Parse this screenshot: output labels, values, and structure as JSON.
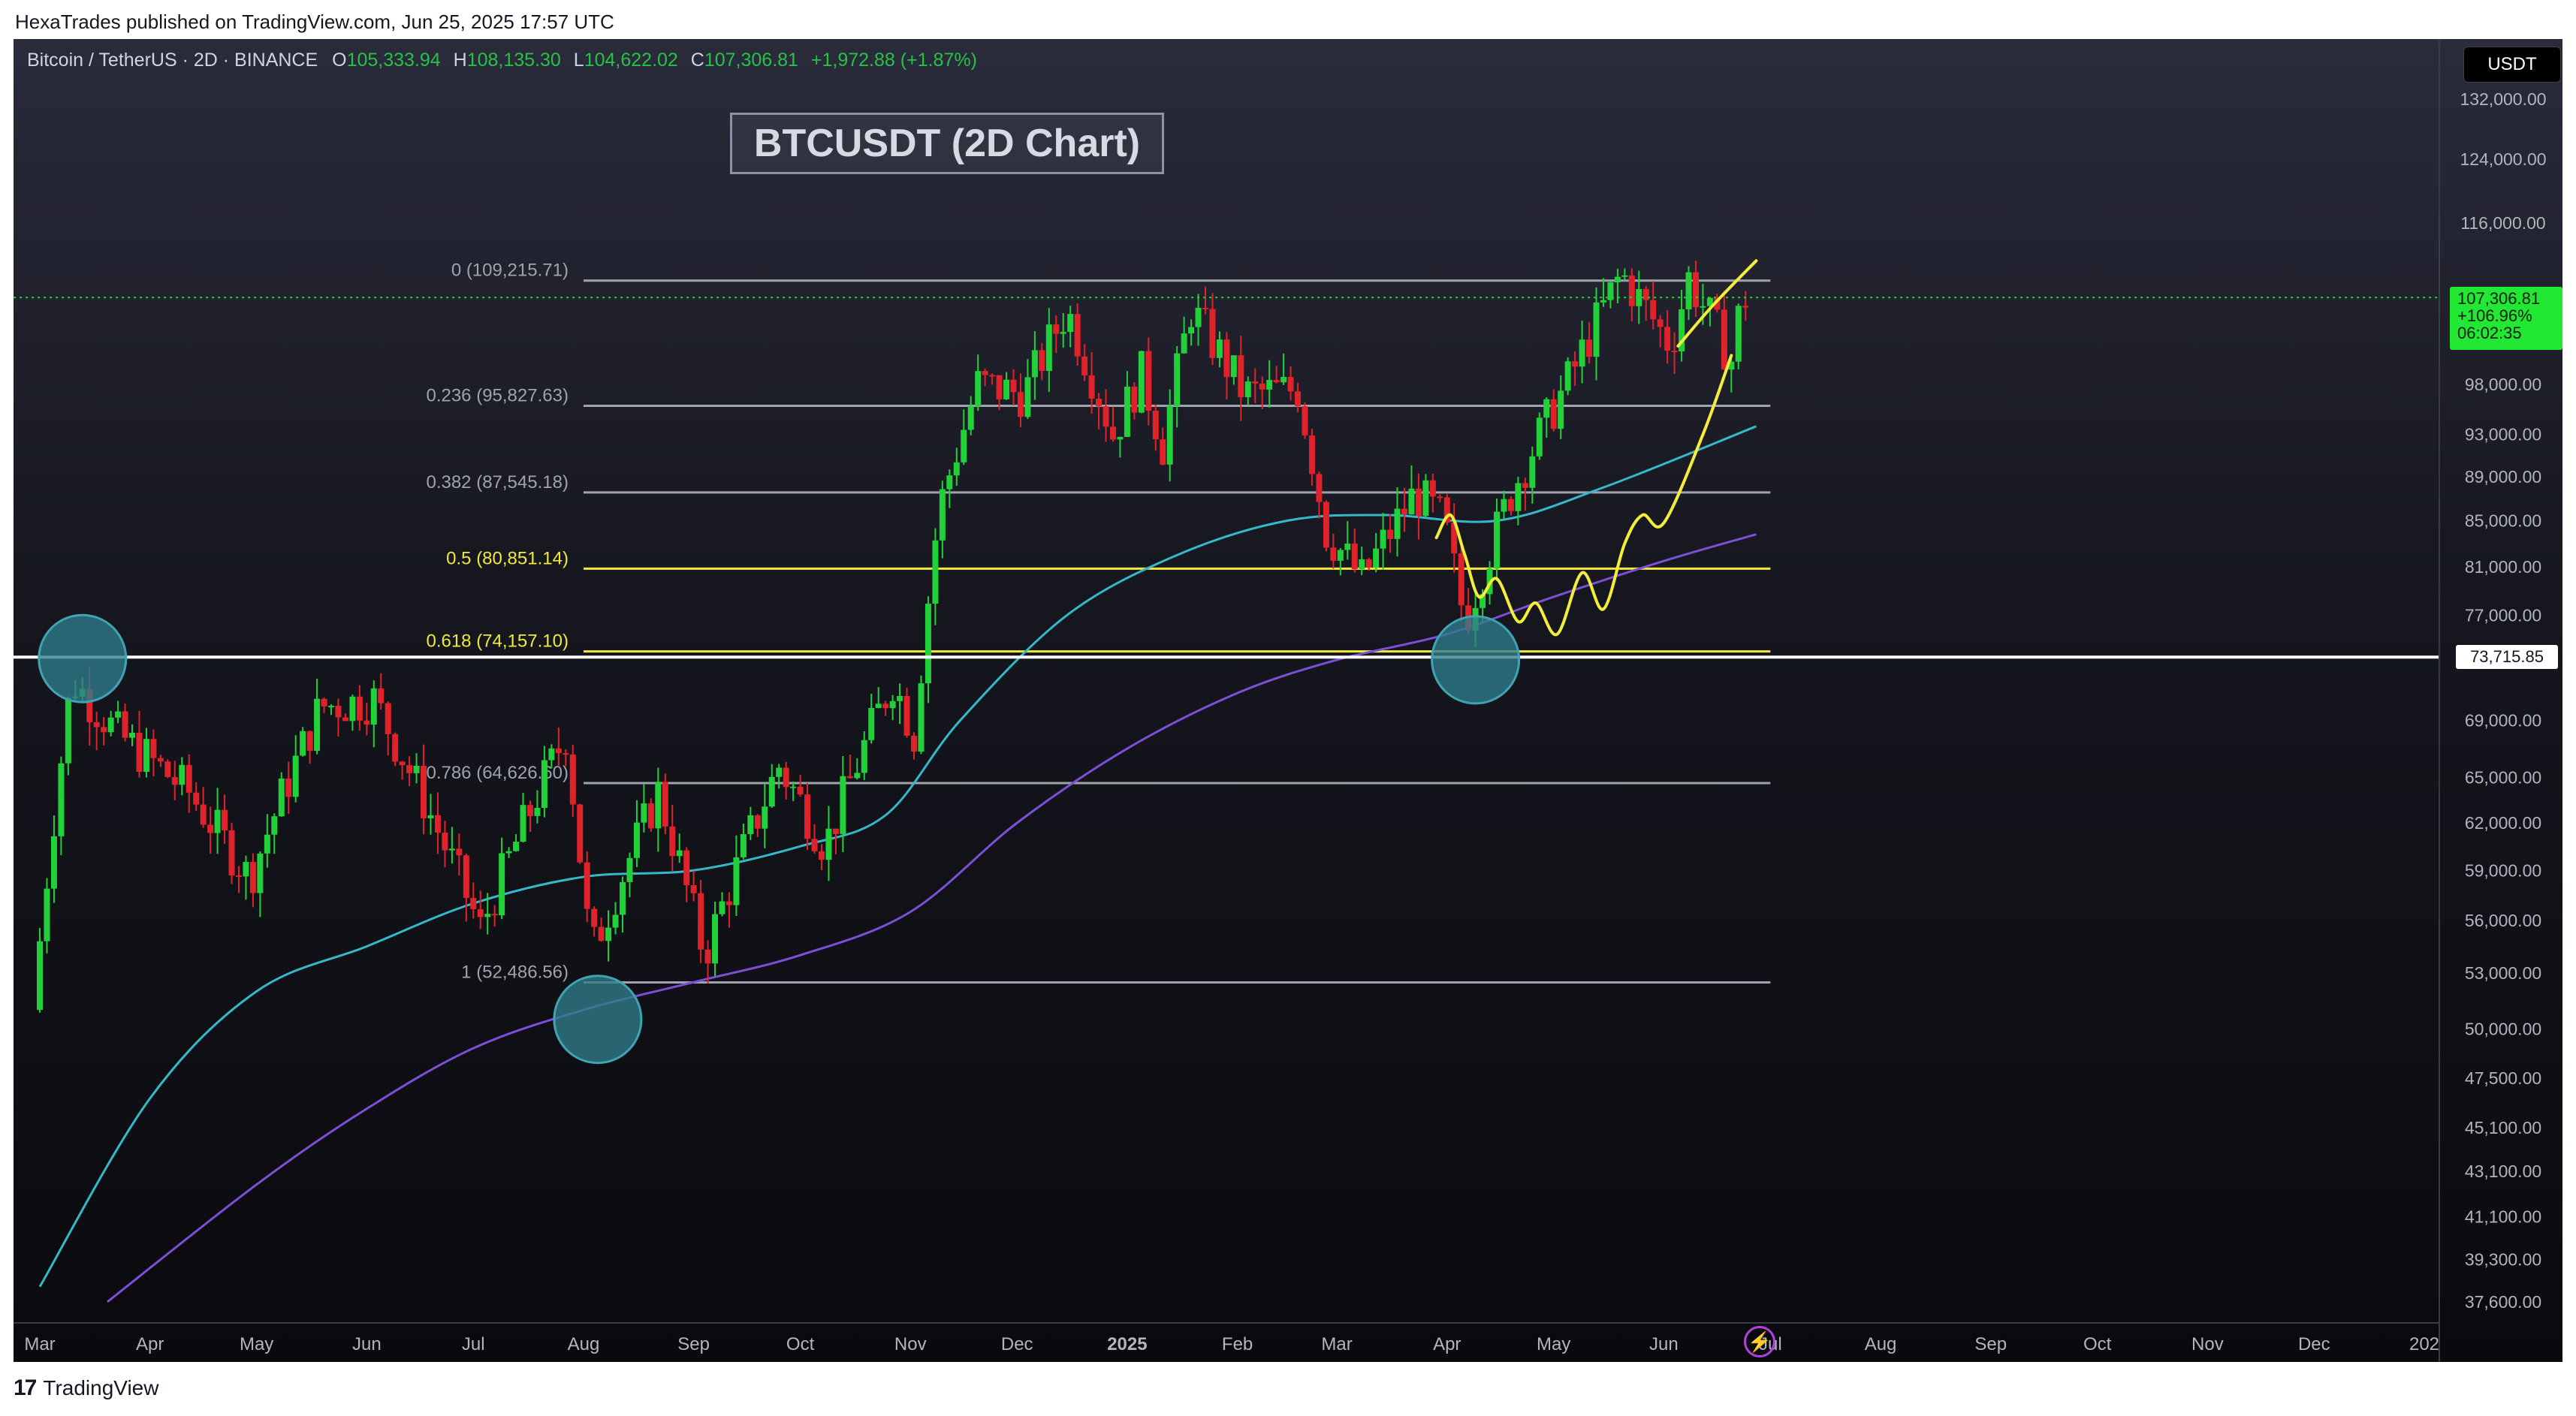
{
  "header": {
    "credit": "HexaTrades published on TradingView.com, Jun 25, 2025 17:57 UTC"
  },
  "legend": {
    "symbol": "Bitcoin / TetherUS · 2D · BINANCE",
    "o_label": "O",
    "o_value": "105,333.94",
    "h_label": "H",
    "h_value": "108,135.30",
    "l_label": "L",
    "l_value": "104,622.02",
    "c_label": "C",
    "c_value": "107,306.81",
    "change": "+1,972.88 (+1.87%)"
  },
  "toolbar": {
    "currency": "USDT"
  },
  "price_badge": {
    "price": "107,306.81",
    "pct": "+106.96%",
    "countdown": "06:02:35"
  },
  "level_badge": "73,715.85",
  "footer": {
    "logo_glyph": "17",
    "brand": "TradingView"
  },
  "colors": {
    "bull": "#22d03a",
    "bear": "#e0232b",
    "ema_fast": "#35b8c8",
    "ema_slow": "#7b4fd6",
    "fib_grey": "#9ea3ad",
    "fib_yellow": "#f2e93a",
    "projection": "#f4ee3a",
    "circle": "#2f7d8c"
  },
  "icons": {
    "bolt": "lightning-icon"
  },
  "chart_data": {
    "type": "candlestick",
    "title": "BTCUSDT (2D Chart)",
    "scale": "log",
    "y_ticks": [
      132000,
      124000,
      116000,
      98000,
      93000,
      89000,
      85000,
      81000,
      77000,
      69000,
      65000,
      62000,
      59000,
      56000,
      53000,
      50000,
      47500,
      45100,
      43100,
      41100,
      39300,
      37600
    ],
    "y_tick_labels": [
      "132,000.00",
      "124,000.00",
      "116,000.00",
      "98,000.00",
      "93,000.00",
      "89,000.00",
      "85,000.00",
      "81,000.00",
      "77,000.00",
      "69,000.00",
      "65,000.00",
      "62,000.00",
      "59,000.00",
      "56,000.00",
      "53,000.00",
      "50,000.00",
      "47,500.00",
      "45,100.00",
      "43,100.00",
      "41,100.00",
      "39,300.00",
      "37,600.00"
    ],
    "x_start": "2024-03-01",
    "x_end": "2026-01-01",
    "x_ticks": [
      {
        "label": "Mar",
        "date": "2024-03-01"
      },
      {
        "label": "Apr",
        "date": "2024-04-01"
      },
      {
        "label": "May",
        "date": "2024-05-01"
      },
      {
        "label": "Jun",
        "date": "2024-06-01"
      },
      {
        "label": "Jul",
        "date": "2024-07-01"
      },
      {
        "label": "Aug",
        "date": "2024-08-01"
      },
      {
        "label": "Sep",
        "date": "2024-09-01"
      },
      {
        "label": "Oct",
        "date": "2024-10-01"
      },
      {
        "label": "Nov",
        "date": "2024-11-01"
      },
      {
        "label": "Dec",
        "date": "2024-12-01"
      },
      {
        "label": "2025",
        "date": "2025-01-01"
      },
      {
        "label": "Feb",
        "date": "2025-02-01"
      },
      {
        "label": "Mar",
        "date": "2025-03-01"
      },
      {
        "label": "Apr",
        "date": "2025-04-01"
      },
      {
        "label": "May",
        "date": "2025-05-01"
      },
      {
        "label": "Jun",
        "date": "2025-06-01"
      },
      {
        "label": "Jul",
        "date": "2025-07-01"
      },
      {
        "label": "Aug",
        "date": "2025-08-01"
      },
      {
        "label": "Sep",
        "date": "2025-09-01"
      },
      {
        "label": "Oct",
        "date": "2025-10-01"
      },
      {
        "label": "Nov",
        "date": "2025-11-01"
      },
      {
        "label": "Dec",
        "date": "2025-12-01"
      },
      {
        "label": "202",
        "date": "2026-01-01"
      }
    ],
    "price_anchors": [
      {
        "date": "2024-03-01",
        "price": 51000
      },
      {
        "date": "2024-03-12",
        "price": 72000
      },
      {
        "date": "2024-03-25",
        "price": 68000
      },
      {
        "date": "2024-04-14",
        "price": 64000
      },
      {
        "date": "2024-05-01",
        "price": 58500
      },
      {
        "date": "2024-05-21",
        "price": 70000
      },
      {
        "date": "2024-06-05",
        "price": 70500
      },
      {
        "date": "2024-06-24",
        "price": 61000
      },
      {
        "date": "2024-07-05",
        "price": 55500
      },
      {
        "date": "2024-07-29",
        "price": 68000
      },
      {
        "date": "2024-08-05",
        "price": 54000
      },
      {
        "date": "2024-08-24",
        "price": 64000
      },
      {
        "date": "2024-09-06",
        "price": 54000
      },
      {
        "date": "2024-09-27",
        "price": 65800
      },
      {
        "date": "2024-10-10",
        "price": 60500
      },
      {
        "date": "2024-10-29",
        "price": 72000
      },
      {
        "date": "2024-11-04",
        "price": 68000
      },
      {
        "date": "2024-11-11",
        "price": 86000
      },
      {
        "date": "2024-11-22",
        "price": 98000
      },
      {
        "date": "2024-12-05",
        "price": 97000
      },
      {
        "date": "2024-12-17",
        "price": 106000
      },
      {
        "date": "2024-12-30",
        "price": 93000
      },
      {
        "date": "2025-01-07",
        "price": 99000
      },
      {
        "date": "2025-01-13",
        "price": 92000
      },
      {
        "date": "2025-01-21",
        "price": 106000
      },
      {
        "date": "2025-02-05",
        "price": 97000
      },
      {
        "date": "2025-02-20",
        "price": 97500
      },
      {
        "date": "2025-02-28",
        "price": 84000
      },
      {
        "date": "2025-03-10",
        "price": 80000
      },
      {
        "date": "2025-03-25",
        "price": 87500
      },
      {
        "date": "2025-04-02",
        "price": 85000
      },
      {
        "date": "2025-04-08",
        "price": 76500
      },
      {
        "date": "2025-04-21",
        "price": 87500
      },
      {
        "date": "2025-05-08",
        "price": 99000
      },
      {
        "date": "2025-05-22",
        "price": 110000
      },
      {
        "date": "2025-06-05",
        "price": 102000
      },
      {
        "date": "2025-06-10",
        "price": 109500
      },
      {
        "date": "2025-06-22",
        "price": 100500
      },
      {
        "date": "2025-06-25",
        "price": 107306.81
      }
    ],
    "ema_fast": [
      {
        "date": "2024-03-01",
        "price": 38200
      },
      {
        "date": "2024-04-01",
        "price": 46500
      },
      {
        "date": "2024-05-01",
        "price": 52000
      },
      {
        "date": "2024-06-01",
        "price": 54500
      },
      {
        "date": "2024-07-01",
        "price": 57000
      },
      {
        "date": "2024-08-01",
        "price": 58600
      },
      {
        "date": "2024-09-01",
        "price": 59000
      },
      {
        "date": "2024-10-01",
        "price": 60500
      },
      {
        "date": "2024-10-25",
        "price": 62500
      },
      {
        "date": "2024-11-15",
        "price": 69000
      },
      {
        "date": "2024-12-15",
        "price": 77000
      },
      {
        "date": "2025-01-15",
        "price": 82000
      },
      {
        "date": "2025-02-15",
        "price": 85000
      },
      {
        "date": "2025-03-15",
        "price": 85500
      },
      {
        "date": "2025-04-15",
        "price": 85000
      },
      {
        "date": "2025-05-15",
        "price": 88000
      },
      {
        "date": "2025-06-27",
        "price": 93800
      }
    ],
    "ema_slow": [
      {
        "date": "2024-03-20",
        "price": 37600
      },
      {
        "date": "2024-05-01",
        "price": 42500
      },
      {
        "date": "2024-06-01",
        "price": 46000
      },
      {
        "date": "2024-07-01",
        "price": 49000
      },
      {
        "date": "2024-08-01",
        "price": 51000
      },
      {
        "date": "2024-09-01",
        "price": 52500
      },
      {
        "date": "2024-10-01",
        "price": 54000
      },
      {
        "date": "2024-11-01",
        "price": 56500
      },
      {
        "date": "2024-12-01",
        "price": 62000
      },
      {
        "date": "2025-01-01",
        "price": 67000
      },
      {
        "date": "2025-02-01",
        "price": 71000
      },
      {
        "date": "2025-03-01",
        "price": 73500
      },
      {
        "date": "2025-04-01",
        "price": 75500
      },
      {
        "date": "2025-05-01",
        "price": 78500
      },
      {
        "date": "2025-06-01",
        "price": 81500
      },
      {
        "date": "2025-06-27",
        "price": 83800
      }
    ],
    "fib_start": "2024-08-01",
    "fib_end": "2025-07-01",
    "fib_levels": [
      {
        "label": "0 (109,215.71)",
        "price": 109215.71,
        "color": "grey"
      },
      {
        "label": "0.236 (95,827.63)",
        "price": 95827.63,
        "color": "grey"
      },
      {
        "label": "0.382 (87,545.18)",
        "price": 87545.18,
        "color": "grey"
      },
      {
        "label": "0.5 (80,851.14)",
        "price": 80851.14,
        "color": "yellow"
      },
      {
        "label": "0.618 (74,157.10)",
        "price": 74157.1,
        "color": "yellow"
      },
      {
        "label": "0.786 (64,626.60)",
        "price": 64626.6,
        "color": "grey"
      },
      {
        "label": "1 (52,486.56)",
        "price": 52486.56,
        "color": "grey"
      }
    ],
    "horizontal_level": 73715.85,
    "current_price": 107306.81,
    "circles": [
      {
        "date": "2024-03-13",
        "price": 73600
      },
      {
        "date": "2024-08-05",
        "price": 50500
      },
      {
        "date": "2025-04-09",
        "price": 73500
      }
    ],
    "projection_paths": [
      [
        {
          "date": "2025-06-05",
          "price": 102000
        },
        {
          "date": "2025-06-15",
          "price": 106500
        },
        {
          "date": "2025-06-27",
          "price": 111500
        }
      ],
      [
        {
          "date": "2025-03-29",
          "price": 83500
        },
        {
          "date": "2025-04-02",
          "price": 85500
        },
        {
          "date": "2025-04-06",
          "price": 82000
        },
        {
          "date": "2025-04-10",
          "price": 78500
        },
        {
          "date": "2025-04-15",
          "price": 80000
        },
        {
          "date": "2025-04-21",
          "price": 76500
        },
        {
          "date": "2025-04-26",
          "price": 78000
        },
        {
          "date": "2025-05-02",
          "price": 75500
        },
        {
          "date": "2025-05-09",
          "price": 80500
        },
        {
          "date": "2025-05-15",
          "price": 77500
        },
        {
          "date": "2025-05-21",
          "price": 83000
        },
        {
          "date": "2025-05-26",
          "price": 85500
        },
        {
          "date": "2025-06-01",
          "price": 84800
        },
        {
          "date": "2025-06-12",
          "price": 93000
        },
        {
          "date": "2025-06-20",
          "price": 101000
        }
      ]
    ]
  }
}
